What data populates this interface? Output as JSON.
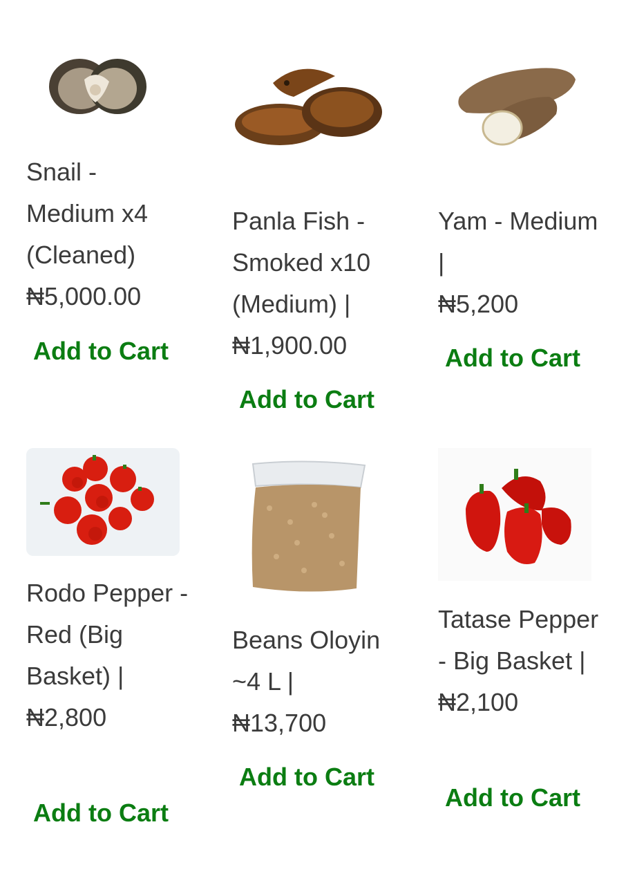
{
  "products": [
    {
      "name": "Snail - Medium x4 (Cleaned)",
      "price": "₦5,000.00",
      "cta": "Add to Cart",
      "image": "snail"
    },
    {
      "name": "Panla Fish - Smoked x10 (Medium) |",
      "price": "₦1,900.00",
      "cta": "Add to Cart",
      "image": "smoked-fish"
    },
    {
      "name": "Yam - Medium |",
      "price": "₦5,200",
      "cta": "Add to Cart",
      "image": "yam"
    },
    {
      "name": "Rodo Pepper - Red (Big Basket) |",
      "price": "₦2,800",
      "cta": "Add to Cart",
      "image": "rodo-pepper"
    },
    {
      "name": "Beans Oloyin ~4 L |",
      "price": "₦13,700",
      "cta": "Add to Cart",
      "image": "beans-bag"
    },
    {
      "name": "Tatase Pepper - Big Basket |",
      "price": "₦2,100",
      "cta": "Add to Cart",
      "image": "tatase-pepper"
    }
  ],
  "colors": {
    "cta": "#0b7d12",
    "text": "#3b3b3b"
  }
}
